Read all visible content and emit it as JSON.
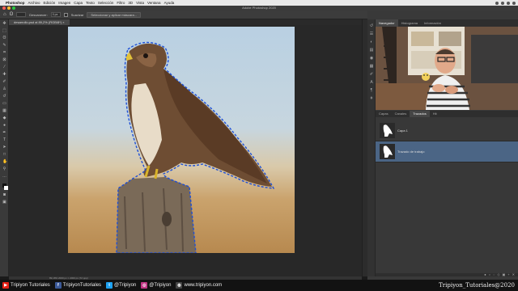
{
  "menubar": {
    "app": "Photoshop",
    "items": [
      "Archivo",
      "Edición",
      "Imagen",
      "Capa",
      "Texto",
      "Selección",
      "Filtro",
      "3D",
      "Vista",
      "Ventana",
      "Ayuda"
    ]
  },
  "window_title": "Adobe Photoshop 2020",
  "options": {
    "desvanecer_label": "Desvanecer:",
    "desvanecer_value": "0 px",
    "suavizar_label": "Suavizar",
    "select_mask_button": "Seleccionar y aplicar máscara..."
  },
  "doc_tab": "desarrollo.psd al 89,2% (RGB/8*) ×",
  "status": "89,18%   2000 px × 2000 px (72 ppp)",
  "panels": {
    "top_tabs": [
      "Navegador",
      "Histograma",
      "Información"
    ],
    "layer_tabs": [
      "Capas",
      "Canales",
      "Trazados",
      "Hit"
    ],
    "layers": [
      {
        "name": "Capa 1",
        "selected": false
      },
      {
        "name": "Trazado de trabajo",
        "selected": true
      }
    ]
  },
  "footer": {
    "youtube": "Tripiyon Tutoriales",
    "facebook": "TripiyonTutoriales",
    "twitter": "@Tripiyon",
    "instagram": "@Tripiyon",
    "web": "www.tripiyon.com",
    "signature": "Tripiyon_Tutoriales@2020"
  }
}
